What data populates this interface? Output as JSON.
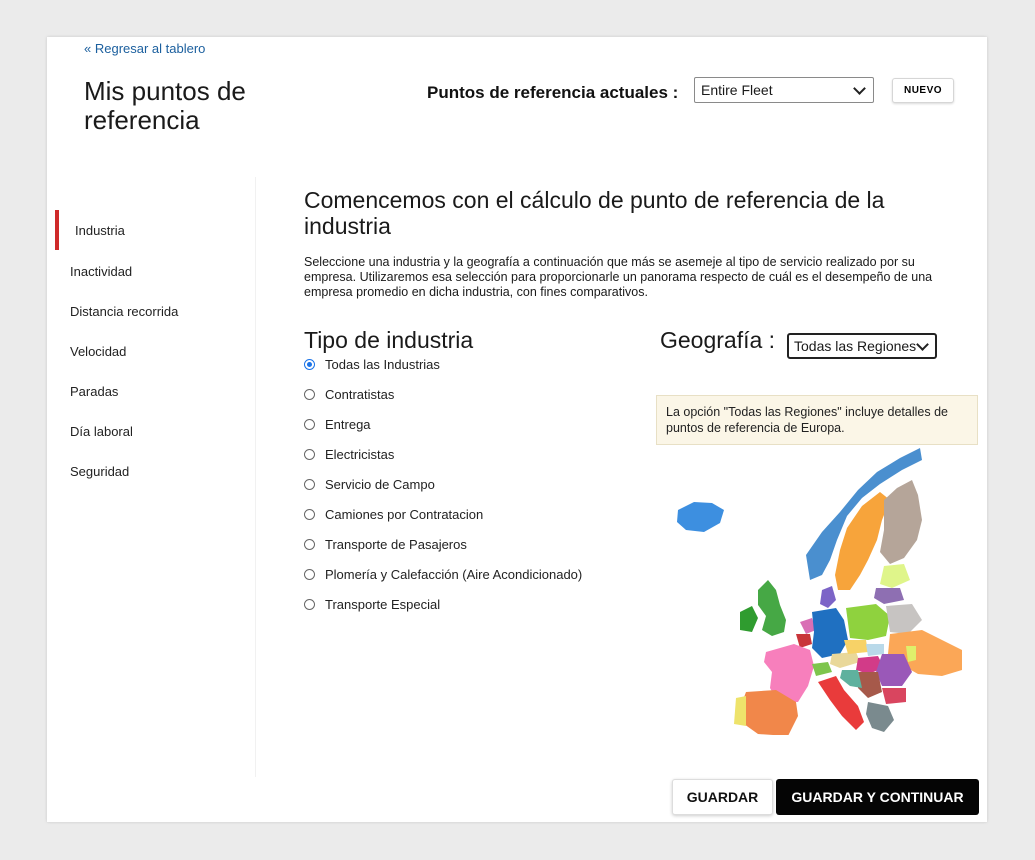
{
  "header": {
    "back_link": "« Regresar al tablero",
    "title": "Mis puntos de referencia",
    "current_label": "Puntos de referencia actuales :",
    "current_value": "Entire Fleet",
    "new_button": "NUEVO"
  },
  "sidebar": {
    "items": [
      {
        "label": "Industria",
        "active": true
      },
      {
        "label": "Inactividad"
      },
      {
        "label": "Distancia recorrida"
      },
      {
        "label": "Velocidad"
      },
      {
        "label": "Paradas"
      },
      {
        "label": "Día laboral"
      },
      {
        "label": "Seguridad"
      }
    ]
  },
  "main": {
    "heading": "Comencemos con el cálculo de punto de referencia de la industria",
    "description": "Seleccione una industria y la geografía a continuación que más se asemeje al tipo de servicio realizado por su empresa. Utilizaremos esa selección para proporcionarle un panorama respecto de cuál es el desempeño de una empresa promedio en dicha industria, con fines comparativos.",
    "industry_heading": "Tipo de industria",
    "industries": [
      {
        "label": "Todas las Industrias",
        "checked": true
      },
      {
        "label": "Contratistas"
      },
      {
        "label": "Entrega"
      },
      {
        "label": "Electricistas"
      },
      {
        "label": "Servicio de Campo"
      },
      {
        "label": "Camiones por Contratacion"
      },
      {
        "label": "Transporte de Pasajeros"
      },
      {
        "label": "Plomería y Calefacción (Aire Acondicionado)"
      },
      {
        "label": "Transporte Especial"
      }
    ],
    "geo_label": "Geografía :",
    "geo_value": "Todas las Regiones",
    "geo_note": "La opción \"Todas las Regiones\" incluye detalles de puntos de referencia de Europa."
  },
  "footer": {
    "save": "GUARDAR",
    "save_continue": "GUARDAR Y CONTINUAR"
  },
  "colors": {
    "accent_red": "#cf2a2a",
    "link_blue": "#1b5f9e",
    "radio_blue": "#1a73e8",
    "note_bg": "#fbf6e7",
    "primary_button": "#050505"
  }
}
